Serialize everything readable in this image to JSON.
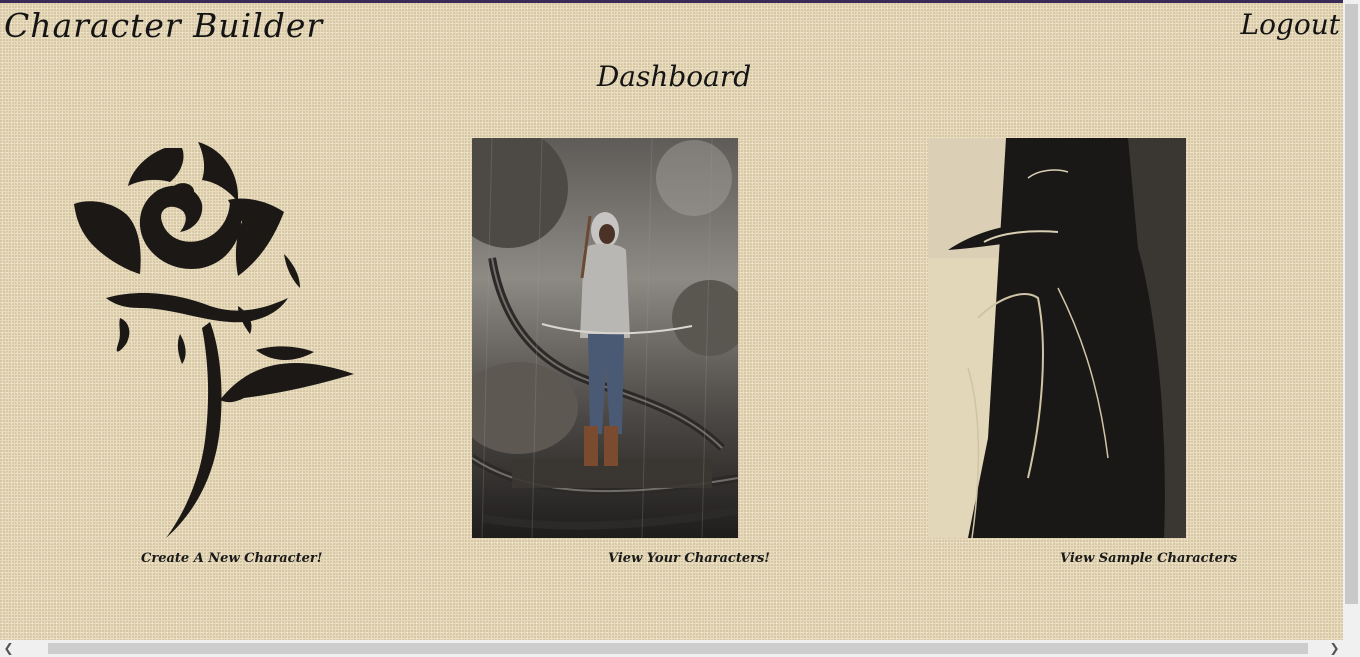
{
  "header": {
    "app_title": "Character Builder",
    "logout_label": "Logout"
  },
  "main": {
    "page_title": "Dashboard",
    "cards": [
      {
        "label": "Create A New Character!",
        "icon": "rose-icon"
      },
      {
        "label": "View Your Characters!",
        "icon": "archer-illustration"
      },
      {
        "label": "View Sample Characters",
        "icon": "detective-illustration"
      }
    ]
  },
  "colors": {
    "background": "#e9dcbc",
    "text": "#141414"
  }
}
